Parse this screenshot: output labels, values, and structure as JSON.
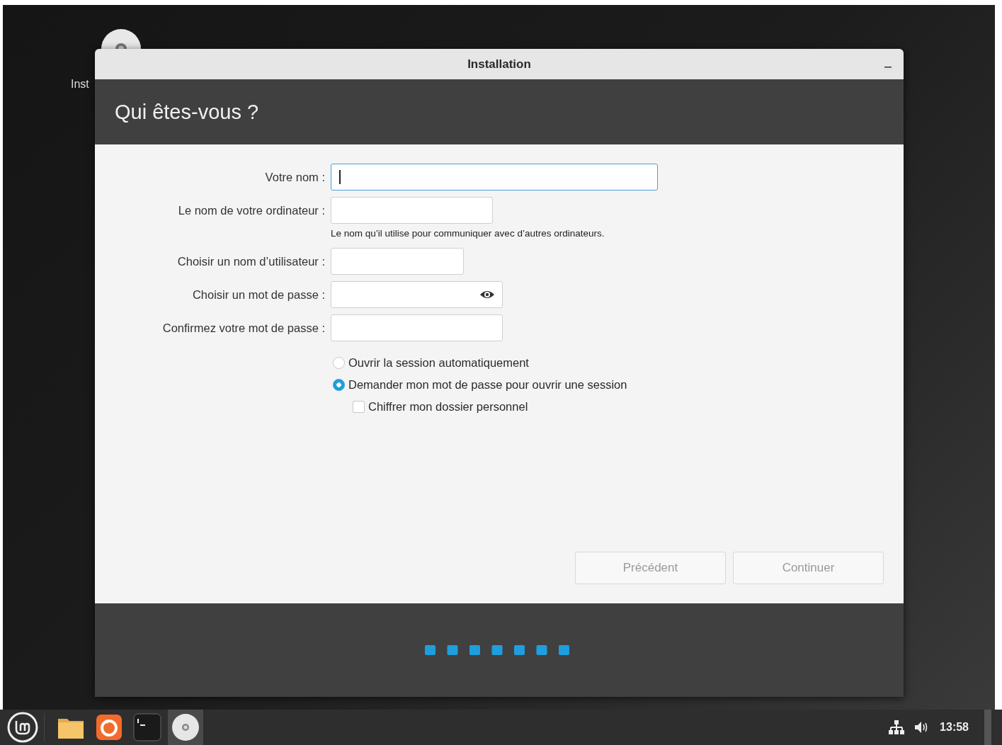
{
  "desktop": {
    "icons": [
      {
        "label": "Inst"
      }
    ]
  },
  "window": {
    "title": "Installation"
  },
  "page_title": "Qui êtes-vous ?",
  "fields": [
    {
      "kind": "text",
      "label": "Votre nom :",
      "focused": true
    },
    {
      "kind": "text",
      "label": "Le nom de votre ordinateur :",
      "focused": false,
      "hint": "Le nom qu’il utilise pour communiquer avec d’autres ordinateurs."
    },
    {
      "kind": "text",
      "label": "Choisir un nom d’utilisateur :",
      "focused": false
    },
    {
      "kind": "password",
      "label": "Choisir un mot de passe :",
      "focused": false
    },
    {
      "kind": "text",
      "label": "Confirmez votre mot de passe :",
      "focused": false
    }
  ],
  "options": [
    {
      "kind": "radio",
      "label": "Ouvrir la session automatiquement",
      "selected": false
    },
    {
      "kind": "radio",
      "label": "Demander mon mot de passe pour ouvrir une session",
      "selected": true
    },
    {
      "kind": "checkbox",
      "label": "Chiffrer mon dossier personnel",
      "checked": false
    }
  ],
  "buttons": [
    {
      "label": "Précédent",
      "disabled": true
    },
    {
      "label": "Continuer",
      "disabled": true
    }
  ],
  "taskbar": {
    "apps": [
      {
        "kind": "files",
        "active": false
      },
      {
        "kind": "browser",
        "active": false
      },
      {
        "kind": "terminal",
        "active": false
      },
      {
        "kind": "disc",
        "active": true
      }
    ],
    "clock": "13:58"
  }
}
